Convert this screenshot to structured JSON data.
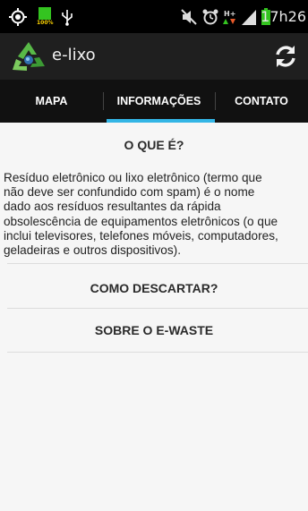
{
  "status_bar": {
    "time": "17h26",
    "icons": [
      "gps-icon",
      "battery-saver-icon",
      "usb-icon",
      "mute-icon",
      "alarm-icon",
      "data-hplus-icon",
      "signal-icon",
      "battery-icon"
    ],
    "badge": "100%"
  },
  "app": {
    "title": "e-lixo",
    "logo": "recycle-icon",
    "refresh_icon": "refresh-icon"
  },
  "tabs": [
    {
      "label": "MAPA"
    },
    {
      "label": "INFORMAÇÕES",
      "selected": true
    },
    {
      "label": "CONTATO"
    }
  ],
  "content": {
    "what_is": {
      "title": "O QUE É?",
      "lines": [
        "Resíduo eletrônico ou lixo eletrônico (termo que",
        "não deve ser confundido com spam) é o nome",
        "dado aos resíduos resultantes da rápida",
        "obsolescência de equipamentos eletrônicos (o que",
        "inclui televisores, telefones móveis, computadores,",
        "geladeiras e outros dispositivos)."
      ]
    },
    "how_to_discard": {
      "title": "COMO DESCARTAR?"
    },
    "about": {
      "title": "SOBRE O E-WASTE"
    }
  },
  "colors": {
    "accent": "#33b5e5",
    "action_bar": "#1f1f1f",
    "tabs_bg": "#111111",
    "status_green": "#34c420"
  }
}
